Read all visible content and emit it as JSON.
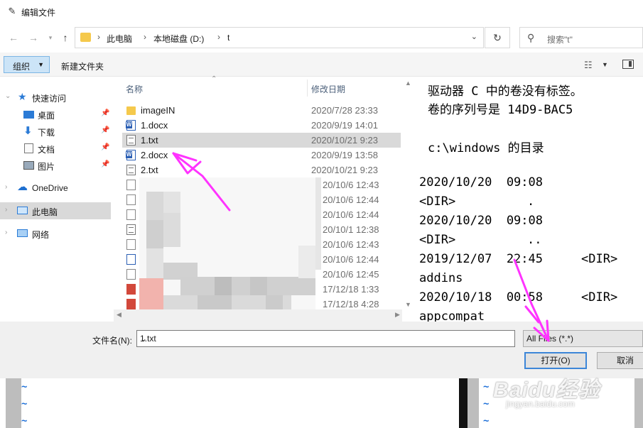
{
  "window": {
    "title": "编辑文件"
  },
  "address": {
    "crumbs": [
      "此电脑",
      "本地磁盘 (D:)",
      "t"
    ],
    "search_placeholder": "搜索\"t\""
  },
  "toolbar": {
    "organize_label": "组织",
    "new_folder_label": "新建文件夹"
  },
  "nav": {
    "quick_access": "快速访问",
    "items": [
      {
        "label": "桌面"
      },
      {
        "label": "下载"
      },
      {
        "label": "文档"
      },
      {
        "label": "图片"
      }
    ],
    "onedrive": "OneDrive",
    "this_pc": "此电脑",
    "network": "网络"
  },
  "list": {
    "col_name": "名称",
    "col_date": "修改日期",
    "rows": [
      {
        "name": "imageIN",
        "date": "2020/7/28 23:33",
        "type": "folder"
      },
      {
        "name": "1.docx",
        "date": "2020/9/19 14:01",
        "type": "doc"
      },
      {
        "name": "1.txt",
        "date": "2020/10/21 9:23",
        "type": "txt"
      },
      {
        "name": "2.docx",
        "date": "2020/9/19 13:58",
        "type": "doc"
      },
      {
        "name": "2.txt",
        "date": "2020/10/21 9:23",
        "type": "txt"
      },
      {
        "name": "",
        "date": "20/10/6 12:43",
        "type": "blank"
      },
      {
        "name": "",
        "date": "20/10/6 12:44",
        "type": "blank"
      },
      {
        "name": "",
        "date": "20/10/6 12:44",
        "type": "blank"
      },
      {
        "name": "",
        "date": "20/10/1 12:38",
        "type": "txt"
      },
      {
        "name": "",
        "date": "20/10/6 12:43",
        "type": "blank"
      },
      {
        "name": "",
        "date": "20/10/6 12:44",
        "type": "blue"
      },
      {
        "name": "",
        "date": "20/10/6 12:45",
        "type": "blank"
      },
      {
        "name": "",
        "date": "17/12/18 1:33",
        "type": "red"
      },
      {
        "name": "",
        "date": "17/12/18 4:28",
        "type": "red"
      }
    ]
  },
  "preview": {
    "lines": [
      "驱动器 C 中的卷没有标签。",
      "卷的序列号是 14D9-BAC5",
      "c:\\windows 的目录",
      "2020/10/20  09:08",
      "<DIR>",
      ".",
      "2020/10/20  09:08",
      "<DIR>",
      "..",
      "2019/12/07  22:45",
      "<DIR>",
      "addins",
      "2020/10/18  00:58",
      "<DIR>",
      "appcompat"
    ]
  },
  "bottom": {
    "filename_label": "文件名(N):",
    "filename_value": "1.txt",
    "filetype_value": "All Files (*.*)",
    "open_label": "打开(O)",
    "cancel_label": "取消"
  },
  "watermark": {
    "logo": "Baidu经验",
    "site": "jingyan.baidu.com"
  },
  "colors": {
    "accent": "#3c86d8",
    "selection": "#d9d9d9",
    "annotation_arrow": "#ff33ff",
    "vim_tilde": "#1c6fd8"
  }
}
